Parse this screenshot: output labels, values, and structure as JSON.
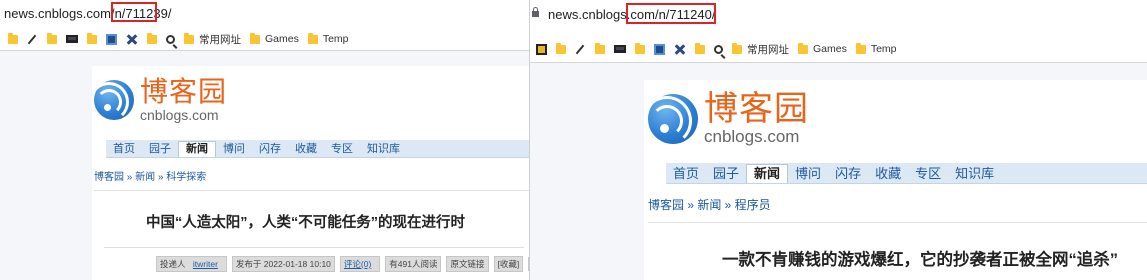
{
  "left": {
    "url_host": "news.cnblogs.com",
    "url_path": "/n/711239/",
    "bookmarks": [
      "",
      "",
      "",
      "",
      "",
      "",
      "",
      "",
      "常用网址",
      "Games",
      "Temp"
    ],
    "logo_cn": "博客园",
    "logo_en": "cnblogs.com",
    "nav": [
      "首页",
      "园子",
      "新闻",
      "博问",
      "闪存",
      "收藏",
      "专区",
      "知识库"
    ],
    "breadcrumb": "博客园 » 新闻 » 科学探索",
    "title": "中国“人造太阳”，人类“不可能任务”的现在进行时",
    "meta": {
      "submitter_label": "投递人",
      "submitter": "itwriter",
      "published": "发布于 2022-01-18 10:10",
      "comments": "评论(0)",
      "reads": "有491人阅读",
      "source": "原文链接",
      "favorite": "[收藏]",
      "more": "« »"
    }
  },
  "right": {
    "url_host": "news.cnblogs.com",
    "url_path": "/n/711240/",
    "bookmarks": [
      "常用网址",
      "Games",
      "Temp"
    ],
    "logo_cn": "博客园",
    "logo_en": "cnblogs.com",
    "nav": [
      "首页",
      "园子",
      "新闻",
      "博问",
      "闪存",
      "收藏",
      "专区",
      "知识库"
    ],
    "breadcrumb": "博客园 » 新闻 » 程序员",
    "title": "一款不肯赚钱的游戏爆红，它的抄袭者正被全网“追杀”"
  },
  "colors": {
    "highlight": "#d9232d",
    "logo_orange": "#e8641a",
    "link_blue": "#1d5aa0"
  }
}
